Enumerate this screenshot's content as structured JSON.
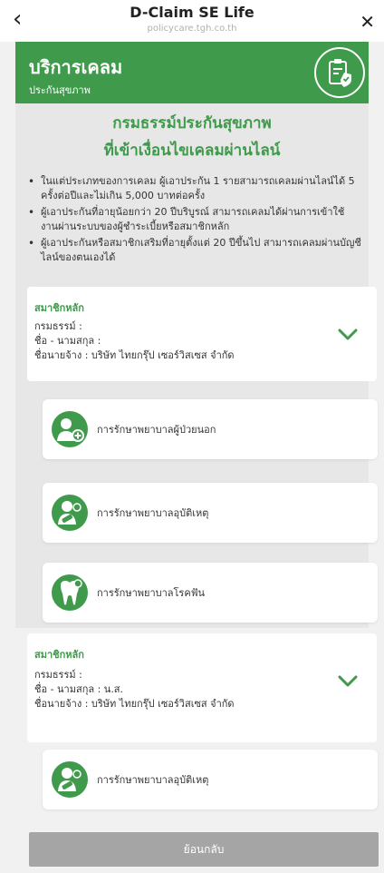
{
  "header": {
    "title": "D-Claim SE Life",
    "url": "policycare.tgh.co.th"
  },
  "banner": {
    "title": "บริการเคลม",
    "subtitle": "ประกันสุขภาพ"
  },
  "info": {
    "heading_line1": "กรมธรรม์ประกันสุขภาพ",
    "heading_line2": "ที่เข้าเงื่อนไขเคลมผ่านไลน์",
    "bullets": [
      "ในแต่ประเภทของการเคลม ผู้เอาประกัน 1 รายสามารถเคลมผ่านไลน์ได้ 5 ครั้งต่อปีและไม่เกิน 5,000 บาทต่อครั้ง",
      "ผู้เอาประกันที่อายุน้อยกว่า 20 ปีบริบูรณ์ สามารถเคลมได้ผ่านการเข้าใช้งานผ่านระบบของผู้ชำระเบี้ยหรือสมาชิกหลัก",
      "ผู้เอาประกันหรือสมาชิกเสริมที่อายุตั้งแต่ 20 ปีขึ้นไป สามารถเคลมผ่านบัญชีไลน์ของตนเองได้"
    ]
  },
  "members": [
    {
      "label": "สมาชิกหลัก",
      "policy": "กรมธรรม์ :",
      "name": "ชื่อ - นามสกุล :",
      "employer": "ชื่อนายจ้าง : บริษัท ไทยกรุ๊ป เซอร์วิสเซส จำกัด",
      "options": [
        {
          "label": "การรักษาพยาบาลผู้ป่วยนอก",
          "icon": "outpatient-icon"
        },
        {
          "label": "การรักษาพยาบาลอุบัติเหตุ",
          "icon": "accident-icon"
        },
        {
          "label": "การรักษาพยาบาลโรคฟัน",
          "icon": "tooth-icon"
        }
      ]
    },
    {
      "label": "สมาชิกหลัก",
      "policy": "กรมธรรม์ :",
      "name": "ชื่อ - นามสกุล : น.ส.",
      "employer": "ชื่อนายจ้าง : บริษัท ไทยกรุ๊ป เซอร์วิสเซส จำกัด",
      "options": [
        {
          "label": "การรักษาพยาบาลอุบัติเหตุ",
          "icon": "accident-icon"
        }
      ]
    }
  ],
  "footer": {
    "back_label": "ย้อนกลับ"
  },
  "colors": {
    "brand_green": "#3f9a4b",
    "disabled_button": "#a5a5a5"
  }
}
